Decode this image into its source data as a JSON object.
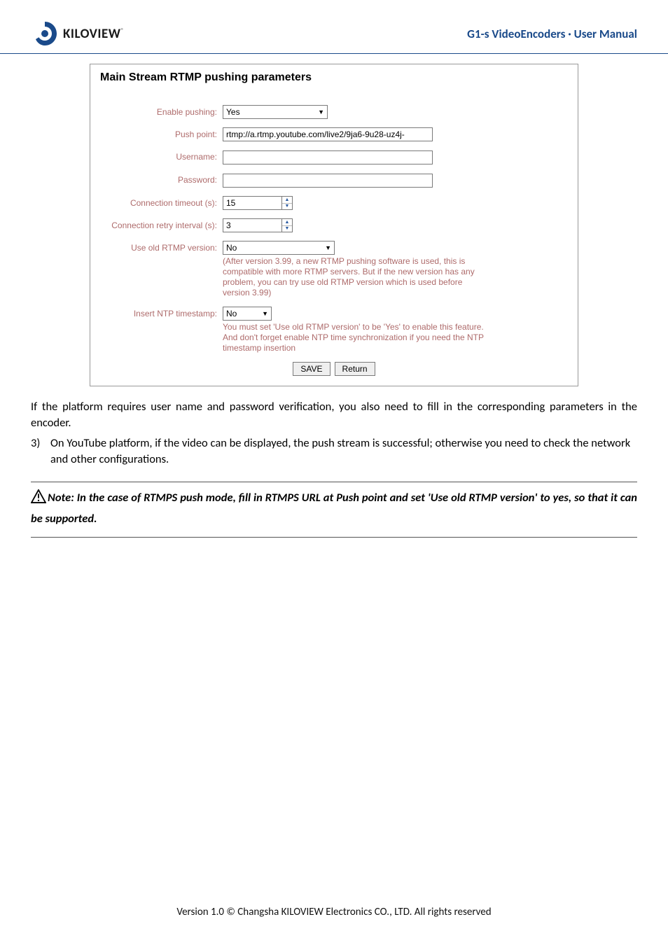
{
  "header": {
    "brand": "KILOVIEW",
    "title": "G1-s VideoEncoders · User Manual"
  },
  "panel": {
    "title": "Main Stream RTMP pushing parameters",
    "labels": {
      "enable": "Enable pushing:",
      "push_point": "Push point:",
      "username": "Username:",
      "password": "Password:",
      "timeout": "Connection timeout (s):",
      "retry": "Connection retry interval (s):",
      "old_rtmp": "Use old RTMP version:",
      "ntp": "Insert NTP timestamp:"
    },
    "values": {
      "enable": "Yes",
      "push_point": "rtmp://a.rtmp.youtube.com/live2/9ja6-9u28-uz4j-",
      "username": "",
      "password": "",
      "timeout": "15",
      "retry": "3",
      "old_rtmp": "No",
      "ntp": "No"
    },
    "hints": {
      "old_rtmp": "(After version 3.99, a new RTMP pushing software is used, this is compatible with more RTMP servers. But if the new version has any problem, you can try use old RTMP version which is used before version 3.99)",
      "ntp": "You must set 'Use old RTMP version' to be 'Yes' to enable this feature. And don't forget enable NTP time synchronization if you need the NTP timestamp insertion"
    },
    "buttons": {
      "save": "SAVE",
      "return": "Return"
    }
  },
  "body": {
    "para1": "If the platform requires user name and password verification, you also need to fill in the corresponding parameters in the encoder.",
    "item3_num": "3)",
    "item3_text": "On YouTube platform, if the video can be displayed, the push stream is successful; otherwise you need to check the network and other configurations.",
    "note": "Note: In the case of RTMPS push mode, fill in RTMPS URL at Push point and set 'Use old RTMP version' to yes, so that it can be supported."
  },
  "footer": "Version 1.0 © Changsha KILOVIEW Electronics CO., LTD. All rights reserved"
}
